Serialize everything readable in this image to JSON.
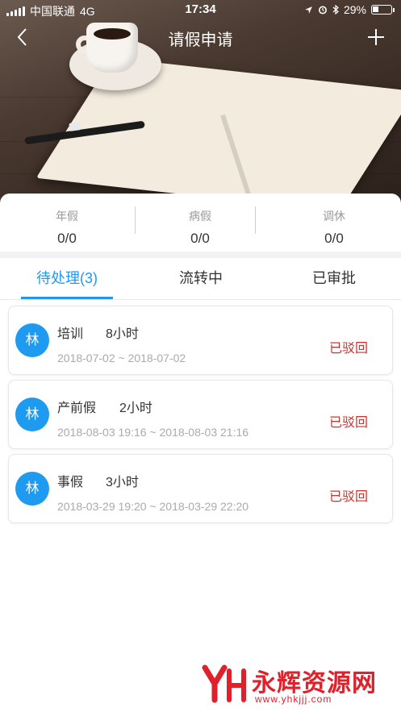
{
  "status_bar": {
    "carrier": "中国联通",
    "network": "4G",
    "time": "17:34",
    "battery": "29%"
  },
  "nav": {
    "title": "请假申请",
    "back_icon": "chevron-left-icon",
    "add_icon": "plus-icon"
  },
  "stats": [
    {
      "label": "年假",
      "value": "0/0"
    },
    {
      "label": "病假",
      "value": "0/0"
    },
    {
      "label": "调休",
      "value": "0/0"
    }
  ],
  "tabs": [
    {
      "label": "待处理(3)",
      "active": true
    },
    {
      "label": "流转中",
      "active": false
    },
    {
      "label": "已审批",
      "active": false
    }
  ],
  "requests": [
    {
      "avatar": "林",
      "type": "培训",
      "hours": "8小时",
      "date_range": "2018-07-02 ~ 2018-07-02",
      "status": "已驳回"
    },
    {
      "avatar": "林",
      "type": "产前假",
      "hours": "2小时",
      "date_range": "2018-08-03 19:16 ~ 2018-08-03 21:16",
      "status": "已驳回"
    },
    {
      "avatar": "林",
      "type": "事假",
      "hours": "3小时",
      "date_range": "2018-03-29 19:20 ~ 2018-03-29 22:20",
      "status": "已驳回"
    }
  ],
  "colors": {
    "accent": "#2196f3",
    "avatar": "#1e9bf0",
    "rejected": "#d0312d"
  },
  "watermark": {
    "text": "永辉资源网",
    "url": "www.yhkjjj.com"
  }
}
